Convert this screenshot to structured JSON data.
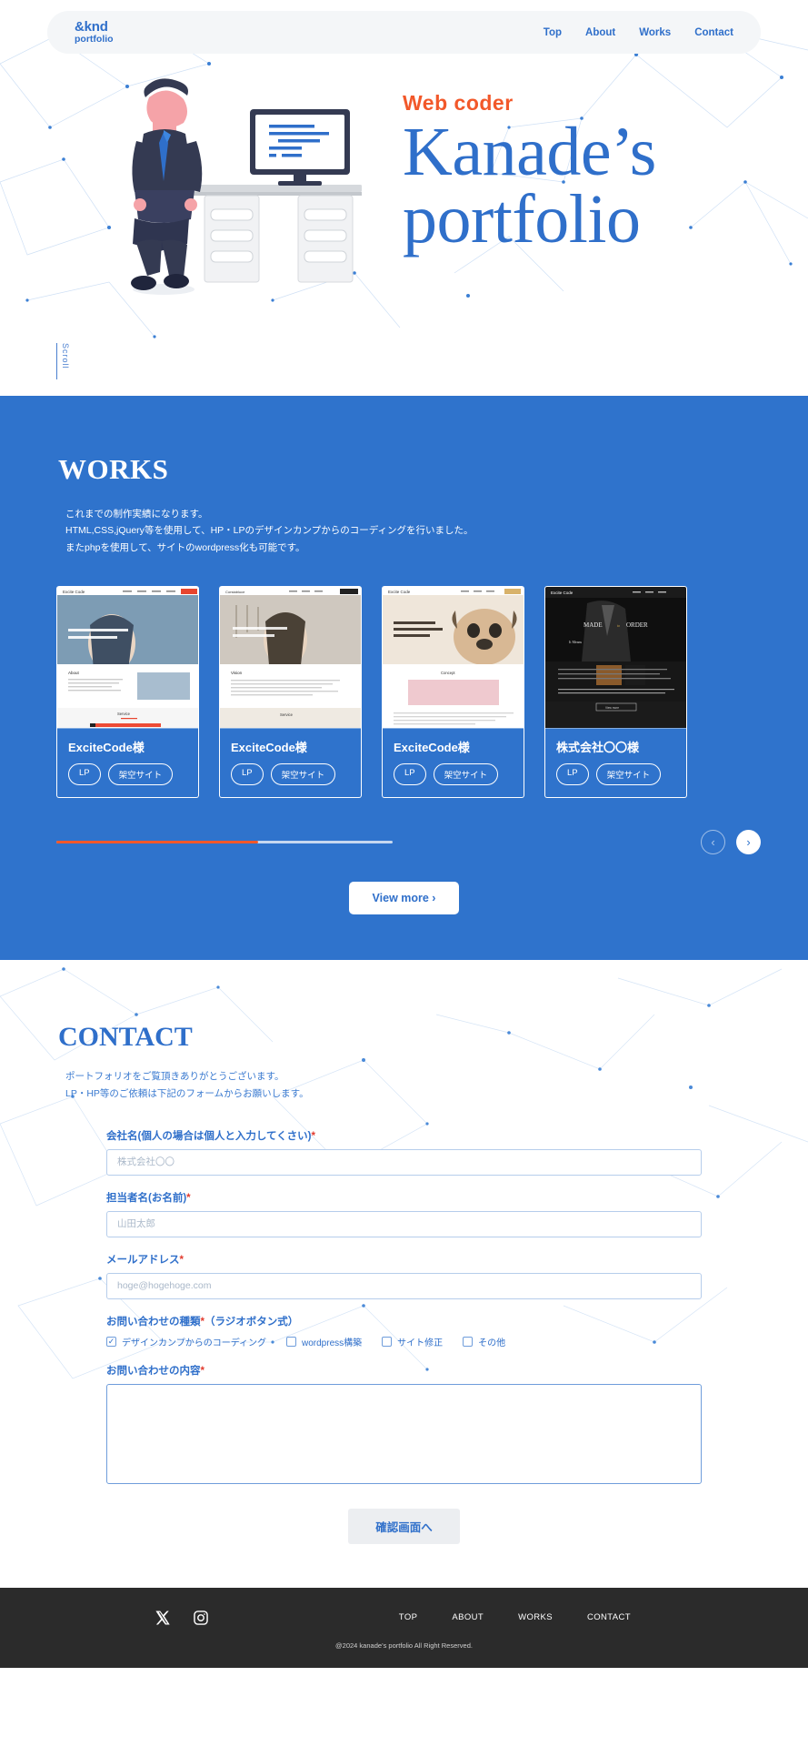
{
  "header": {
    "logo_line1": "&knd",
    "logo_line2": "portfolio",
    "nav": [
      {
        "label": "Top"
      },
      {
        "label": "About"
      },
      {
        "label": "Works"
      },
      {
        "label": "Contact"
      }
    ]
  },
  "hero": {
    "eyebrow": "Web coder",
    "title_line1": "Kanade’s",
    "title_line2": "portfolio",
    "scroll_label": "Scroll",
    "accent_color": "#f2582a",
    "title_color": "#2f6fca"
  },
  "works": {
    "heading": "WORKS",
    "desc_line1": "これまでの制作実績になります。",
    "desc_line2": "HTML,CSS,jQuery等を使用して、HP・LPのデザインカンプからのコーディングを行いました。",
    "desc_line3": "またphpを使用して、サイトのwordpress化も可能です。",
    "background_color": "#2f73cc",
    "cards": [
      {
        "title": "ExciteCode様",
        "tag1": "LP",
        "tag2": "架空サイト",
        "thumb_brand": "Excite Code"
      },
      {
        "title": "ExciteCode様",
        "tag1": "LP",
        "tag2": "架空サイト",
        "thumb_brand": "Corstabluce"
      },
      {
        "title": "ExciteCode様",
        "tag1": "LP",
        "tag2": "架空サイト",
        "thumb_brand": "Excite Code"
      },
      {
        "title": "株式会社〇〇様",
        "tag1": "LP",
        "tag2": "架空サイト",
        "thumb_brand": "Excite Code"
      }
    ],
    "progress_percent": 60,
    "progress_fill_color": "#f2582a",
    "prev_arrow": "‹",
    "next_arrow": "›",
    "view_more": "View more ›"
  },
  "contact": {
    "heading": "CONTACT",
    "desc_line1": "ポートフォリオをご覧頂きありがとうございます。",
    "desc_line2": "LP・HP等のご依頼は下記のフォームからお願いします。",
    "fields": {
      "company_label": "会社名(個人の場合は個人と入力してくさい)",
      "company_placeholder": "株式会社〇〇",
      "company_value": "",
      "name_label": "担当者名(お名前)",
      "name_placeholder": "山田太郎",
      "name_value": "",
      "email_label": "メールアドレス",
      "email_placeholder": "hoge@hogehoge.com",
      "email_value": "",
      "type_label": "お問い合わせの種類",
      "type_suffix": "（ラジオボタン式）",
      "message_label": "お問い合わせの内容",
      "message_value": "",
      "required_mark": "*"
    },
    "options": [
      {
        "label": "デザインカンプからのコーディング",
        "checked": true,
        "mark": "✓"
      },
      {
        "label": "wordpress構築",
        "checked": false,
        "mark": ""
      },
      {
        "label": "サイト修正",
        "checked": false,
        "mark": ""
      },
      {
        "label": "その他",
        "checked": false,
        "mark": ""
      }
    ],
    "submit_label": "確認画面へ"
  },
  "footer": {
    "socials": [
      {
        "name": "x-twitter"
      },
      {
        "name": "instagram"
      }
    ],
    "nav": [
      {
        "label": "TOP"
      },
      {
        "label": "ABOUT"
      },
      {
        "label": "WORKS"
      },
      {
        "label": "CONTACT"
      }
    ],
    "copyright": "@2024 kanade’s portfolio All Right Reserved.",
    "background_color": "#2b2b2b"
  }
}
